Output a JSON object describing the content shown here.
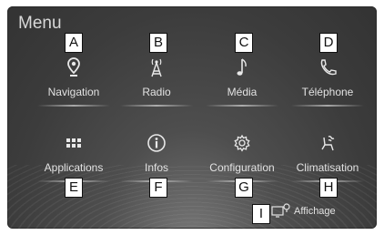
{
  "menu": {
    "title": "Menu",
    "items": [
      {
        "label": "Navigation",
        "icon": "navigation-pin-icon",
        "callout": "A"
      },
      {
        "label": "Radio",
        "icon": "radio-antenna-icon",
        "callout": "B"
      },
      {
        "label": "Média",
        "icon": "music-note-icon",
        "callout": "C"
      },
      {
        "label": "Téléphone",
        "icon": "phone-icon",
        "callout": "D"
      },
      {
        "label": "Applications",
        "icon": "apps-grid-icon",
        "callout": "E"
      },
      {
        "label": "Infos",
        "icon": "info-icon",
        "callout": "F"
      },
      {
        "label": "Configuration",
        "icon": "settings-gear-icon",
        "callout": "G"
      },
      {
        "label": "Climatisation",
        "icon": "climate-seat-icon",
        "callout": "H"
      }
    ],
    "display_button": {
      "label": "Affichage",
      "icon": "display-icon",
      "callout": "I"
    }
  }
}
